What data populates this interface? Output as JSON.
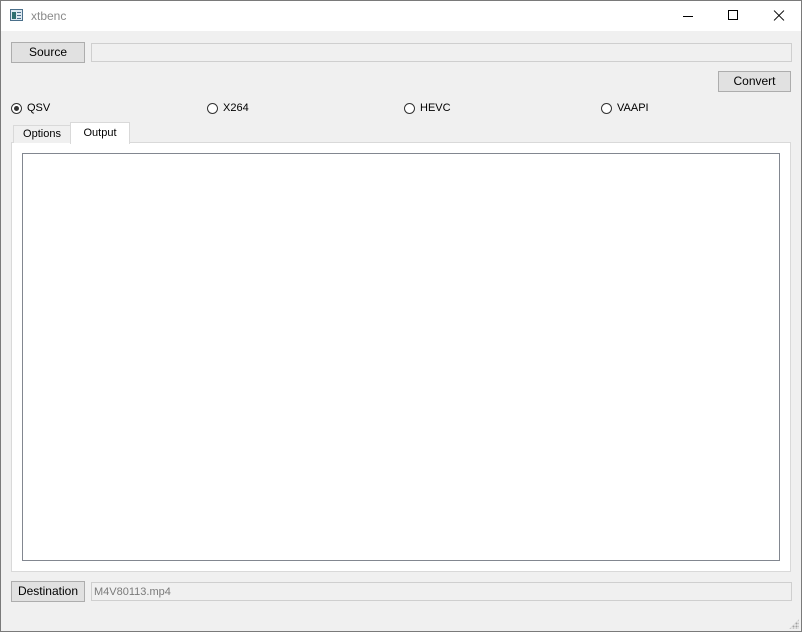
{
  "window": {
    "title": "xtbenc",
    "icon": "app-window-icon",
    "controls": [
      "minimize-icon",
      "maximize-icon",
      "close-icon"
    ]
  },
  "source": {
    "button_label": "Source",
    "path_value": ""
  },
  "convert": {
    "button_label": "Convert"
  },
  "encoders": {
    "options": [
      {
        "label": "QSV",
        "checked": true
      },
      {
        "label": "X264",
        "checked": false
      },
      {
        "label": "HEVC",
        "checked": false
      },
      {
        "label": "VAAPI",
        "checked": false
      }
    ],
    "selected": "QSV"
  },
  "tabs": [
    {
      "label": "Options",
      "active": false
    },
    {
      "label": "Output",
      "active": true
    }
  ],
  "output": {
    "text": ""
  },
  "destination": {
    "button_label": "Destination",
    "path_value": "M4V80113.mp4"
  }
}
